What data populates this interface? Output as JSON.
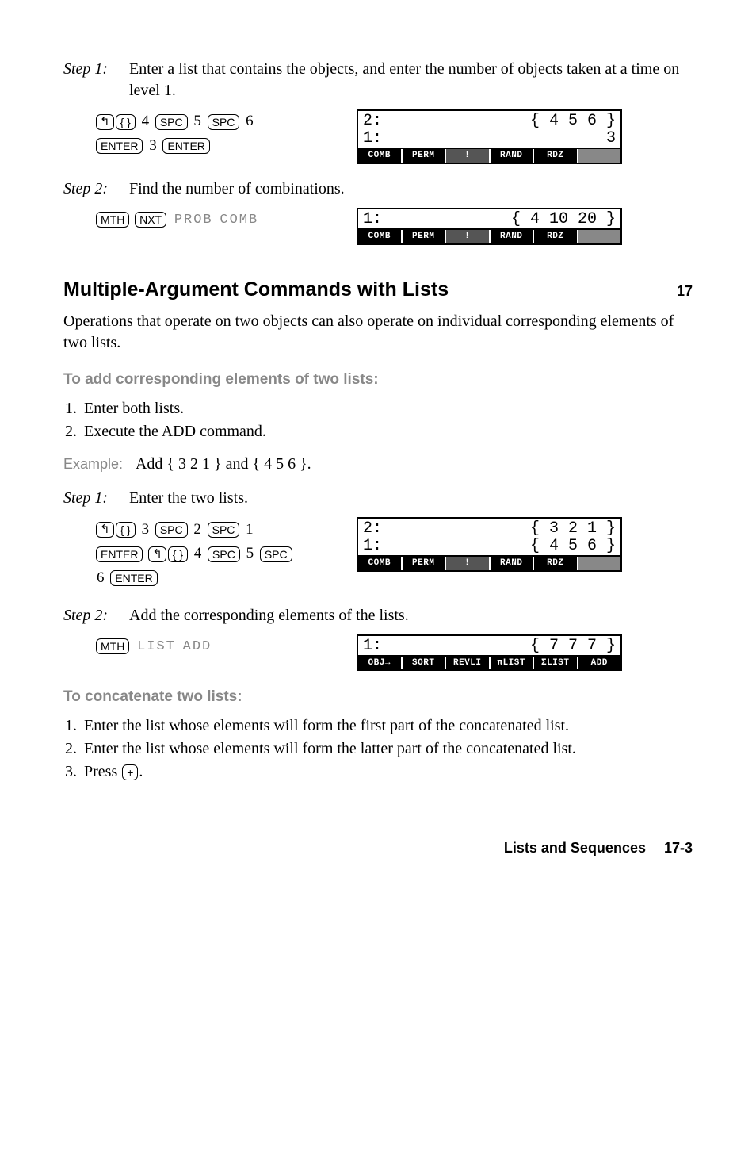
{
  "step1": {
    "label": "Step 1:",
    "text": "Enter a list that contains the objects, and enter the number of objects taken at a time on level 1.",
    "keys": {
      "shift": "↰",
      "brace": "{ }",
      "d4": "4",
      "spc": "SPC",
      "d5": "5",
      "d6": "6",
      "enter": "ENTER",
      "d3": "3"
    },
    "screen": {
      "l2l": "2:",
      "l2r": "{ 4 5 6 }",
      "l1l": "1:",
      "l1r": "3",
      "sk": [
        "COMB",
        "PERM",
        "!",
        "RAND",
        "RDZ",
        ""
      ]
    }
  },
  "step2": {
    "label": "Step 2:",
    "text": "Find the number of combinations.",
    "keys": {
      "mth": "MTH",
      "nxt": "NXT",
      "prob": "PROB",
      "comb": "COMB"
    },
    "screen": {
      "l1l": "1:",
      "l1r": "{ 4 10 20 }",
      "sk": [
        "COMB",
        "PERM",
        "!",
        "RAND",
        "RDZ",
        ""
      ]
    }
  },
  "heading": "Multiple-Argument Commands with Lists",
  "sidepage": "17",
  "intro": "Operations that operate on two objects can also operate on individual corresponding elements of two lists.",
  "sub_add": "To add corresponding elements of two lists:",
  "addlist": {
    "i1": "Enter both lists.",
    "i2": "Execute the ADD command."
  },
  "ex": {
    "label": "Example:",
    "text": "Add { 3 2 1 } and { 4 5 6 }."
  },
  "ex_s1": {
    "label": "Step 1:",
    "text": "Enter the two lists.",
    "keys": {
      "shift": "↰",
      "brace": "{ }",
      "d3": "3",
      "spc": "SPC",
      "d2": "2",
      "d1": "1",
      "enter": "ENTER",
      "d4": "4",
      "d5": "5",
      "d6": "6"
    },
    "screen": {
      "l2l": "2:",
      "l2r": "{ 3 2 1 }",
      "l1l": "1:",
      "l1r": "{ 4 5 6 }",
      "sk": [
        "COMB",
        "PERM",
        "!",
        "RAND",
        "RDZ",
        ""
      ]
    }
  },
  "ex_s2": {
    "label": "Step 2:",
    "text": "Add the corresponding elements of the lists.",
    "keys": {
      "mth": "MTH",
      "list": "LIST",
      "add": "ADD"
    },
    "screen": {
      "l1l": "1:",
      "l1r": "{ 7 7 7 }",
      "sk": [
        "OBJ→",
        "SORT",
        "REVLI",
        "πLIST",
        "ΣLIST",
        "ADD"
      ]
    }
  },
  "sub_concat": "To concatenate two lists:",
  "concat": {
    "i1": "Enter the list whose elements will form the first part of the concatenated list.",
    "i2": "Enter the list whose elements will form the latter part of the concatenated list.",
    "i3_pre": "Press ",
    "i3_key": "+",
    "i3_post": "."
  },
  "footer": "Lists and Sequences  17-3"
}
